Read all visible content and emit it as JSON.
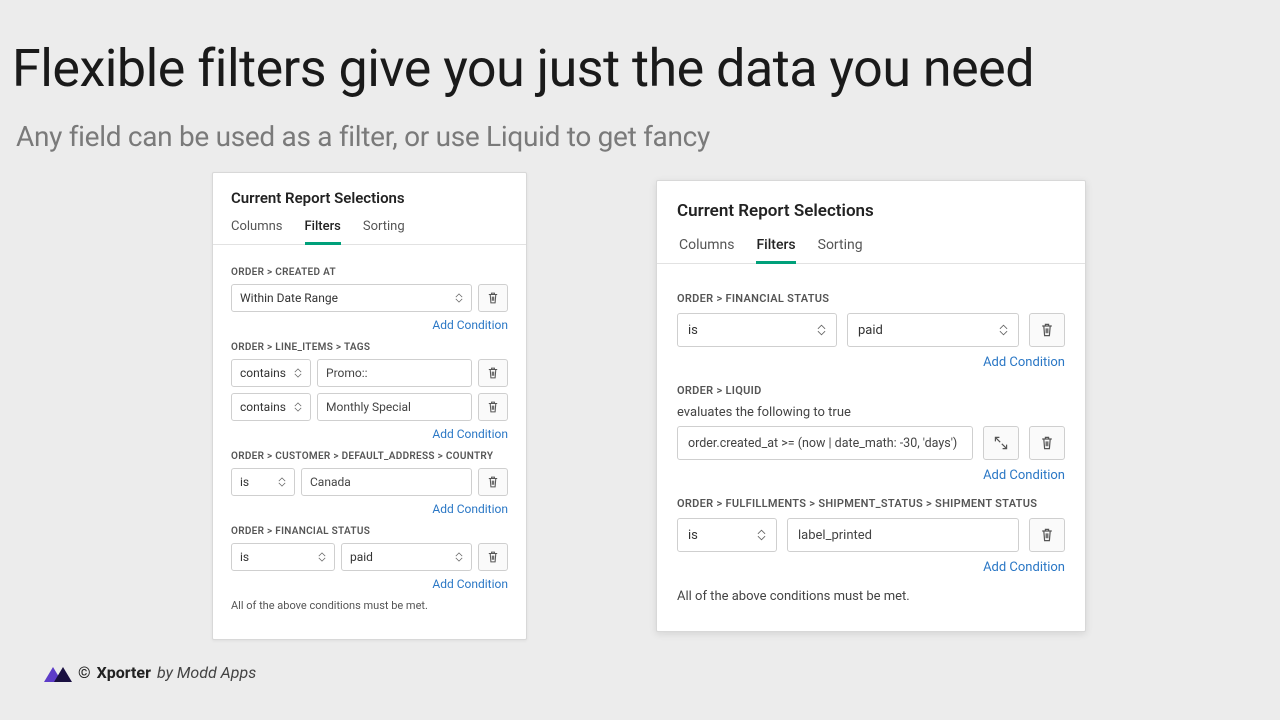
{
  "title": "Flexible filters give you just the data you need",
  "subtitle": "Any field can be used as a filter, or use Liquid to get fancy",
  "add_condition_label": "Add Condition",
  "footnote": "All of the above conditions must be met.",
  "tabs": {
    "columns": "Columns",
    "filters": "Filters",
    "sorting": "Sorting"
  },
  "panel_title": "Current Report Selections",
  "panel_a": {
    "sections": [
      {
        "label": "ORDER > CREATED AT",
        "rows": [
          {
            "kind": "single_select",
            "value": "Within Date Range"
          }
        ]
      },
      {
        "label": "ORDER > LINE_ITEMS > TAGS",
        "rows": [
          {
            "kind": "op_value",
            "op": "contains",
            "value": "Promo::"
          },
          {
            "kind": "op_value",
            "op": "contains",
            "value": "Monthly Special"
          }
        ]
      },
      {
        "label": "ORDER > CUSTOMER > DEFAULT_ADDRESS > COUNTRY",
        "rows": [
          {
            "kind": "op_value",
            "op": "is",
            "value": "Canada"
          }
        ]
      },
      {
        "label": "ORDER > FINANCIAL STATUS",
        "rows": [
          {
            "kind": "op_select",
            "op": "is",
            "value": "paid"
          }
        ]
      }
    ]
  },
  "panel_b": {
    "sections": [
      {
        "label": "ORDER > FINANCIAL STATUS",
        "rows": [
          {
            "kind": "op_select",
            "op": "is",
            "value": "paid"
          }
        ]
      },
      {
        "label": "ORDER > LIQUID",
        "hint": "evaluates the following to true",
        "rows": [
          {
            "kind": "liquid",
            "value": "order.created_at >= (now | date_math: -30, 'days')"
          }
        ]
      },
      {
        "label": "ORDER > FULFILLMENTS > SHIPMENT_STATUS > SHIPMENT STATUS",
        "rows": [
          {
            "kind": "op_value",
            "op": "is",
            "value": "label_printed"
          }
        ]
      }
    ]
  },
  "branding": {
    "copyright": "© ",
    "product": "Xporter",
    "by": "by Modd Apps"
  }
}
